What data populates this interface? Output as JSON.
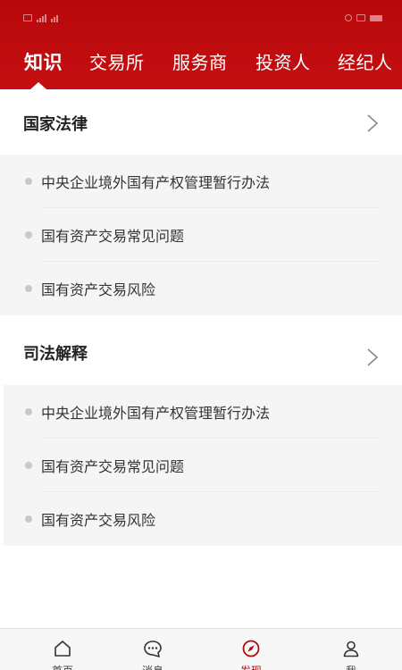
{
  "status_bar": {
    "network_label": ""
  },
  "tabs": [
    {
      "label": "知识",
      "active": true
    },
    {
      "label": "交易所",
      "active": false
    },
    {
      "label": "服务商",
      "active": false
    },
    {
      "label": "投资人",
      "active": false
    },
    {
      "label": "经纪人",
      "active": false
    }
  ],
  "sections": [
    {
      "title": "国家法律",
      "items": [
        "中央企业境外国有产权管理暂行办法",
        "国有资产交易常见问题",
        "国有资产交易风险"
      ]
    },
    {
      "title": "司法解释",
      "items": [
        "中央企业境外国有产权管理暂行办法",
        "国有资产交易常见问题",
        "国有资产交易风险"
      ]
    }
  ],
  "bottom_nav": [
    {
      "label": "首页",
      "icon": "home-icon",
      "active": false
    },
    {
      "label": "消息",
      "icon": "message-icon",
      "active": false
    },
    {
      "label": "发现",
      "icon": "compass-icon",
      "active": true
    },
    {
      "label": "我",
      "icon": "user-icon",
      "active": false
    }
  ],
  "colors": {
    "brand_red": "#c40f12",
    "active_nav": "#b5080b"
  }
}
